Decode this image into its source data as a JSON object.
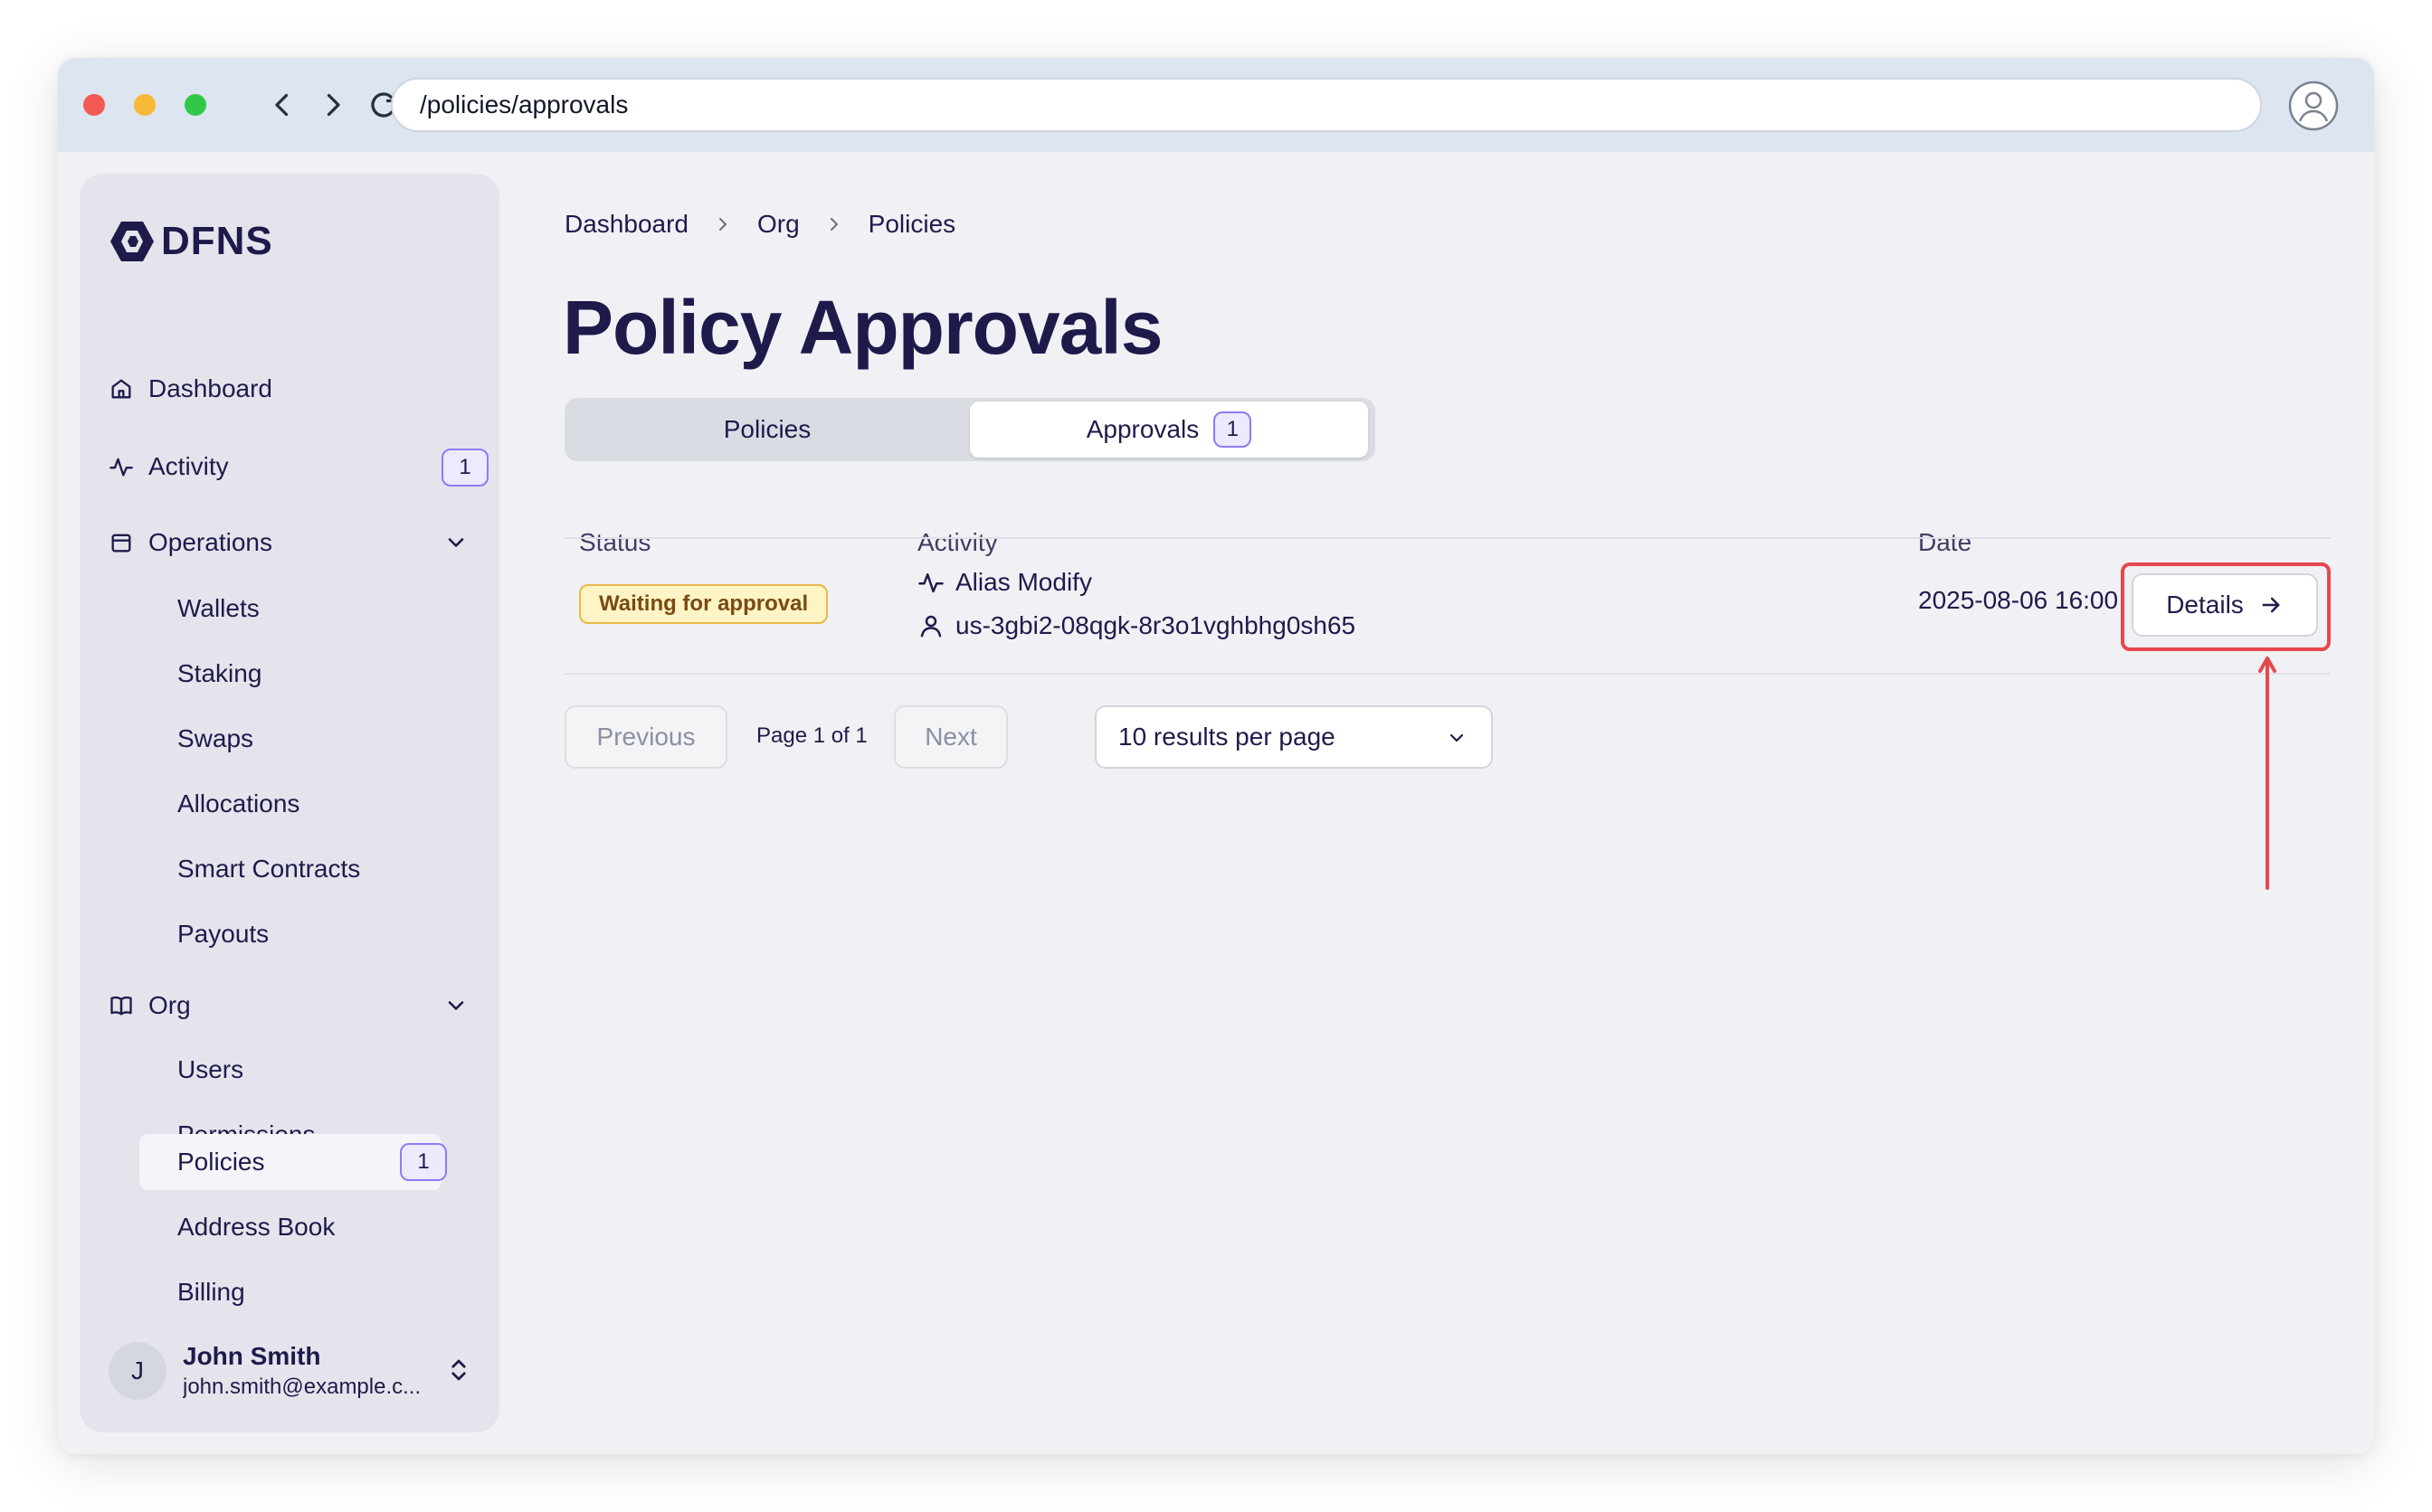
{
  "browser": {
    "url": "/policies/approvals"
  },
  "sidebar": {
    "logo_text": "DFNS",
    "dashboard": "Dashboard",
    "activity": "Activity",
    "activity_count": "1",
    "operations": "Operations",
    "operations_items": [
      "Wallets",
      "Staking",
      "Swaps",
      "Allocations",
      "Smart Contracts",
      "Payouts"
    ],
    "org": "Org",
    "org_items": [
      "Users",
      "Permissions",
      "Policies",
      "Address Book",
      "Billing"
    ],
    "policies_count": "1",
    "user": {
      "initial": "J",
      "name": "John Smith",
      "email": "john.smith@example.c..."
    }
  },
  "breadcrumb": [
    "Dashboard",
    "Org",
    "Policies"
  ],
  "page_title": "Policy Approvals",
  "tabs": {
    "policies": "Policies",
    "approvals": "Approvals",
    "approvals_count": "1"
  },
  "table": {
    "headers": {
      "status": "Status",
      "activity": "Activity",
      "date": "Date"
    },
    "rows": [
      {
        "status": "Waiting for approval",
        "activity": "Alias Modify",
        "user": "us-3gbi2-08qgk-8r3o1vghbhg0sh65",
        "date": "2025-08-06 16:00",
        "action": "Details"
      }
    ]
  },
  "pagination": {
    "previous": "Previous",
    "page_info": "Page 1 of 1",
    "next": "Next",
    "per_page": "10 results per page"
  },
  "colors": {
    "accent": "#8b7cf6",
    "highlight": "#e5484d",
    "status_bg": "#fff4c6"
  }
}
